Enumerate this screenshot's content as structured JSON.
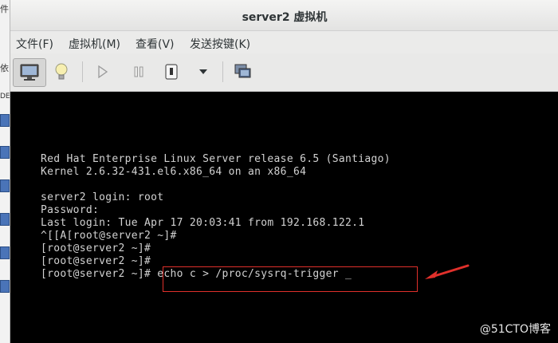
{
  "background": {
    "strip_texts": [
      "件",
      "依",
      "DE"
    ]
  },
  "window": {
    "title": "server2 虚拟机"
  },
  "menubar": {
    "items": [
      "文件(F)",
      "虚拟机(M)",
      "查看(V)",
      "发送按键(K)"
    ]
  },
  "toolbar": {
    "buttons": [
      "console-view",
      "details-view",
      "run",
      "pause",
      "shutdown",
      "shutdown-menu",
      "fullscreen"
    ]
  },
  "console": {
    "lines": [
      "Red Hat Enterprise Linux Server release 6.5 (Santiago)",
      "Kernel 2.6.32-431.el6.x86_64 on an x86_64",
      "",
      "server2 login: root",
      "Password:",
      "Last login: Tue Apr 17 20:03:41 from 192.168.122.1",
      "^[[A[root@server2 ~]#",
      "[root@server2 ~]#",
      "[root@server2 ~]#",
      "[root@server2 ~]# echo c > /proc/sysrq-trigger _"
    ]
  },
  "annotation": {
    "color": "#e0302b"
  },
  "watermark": "@51CTO博客"
}
